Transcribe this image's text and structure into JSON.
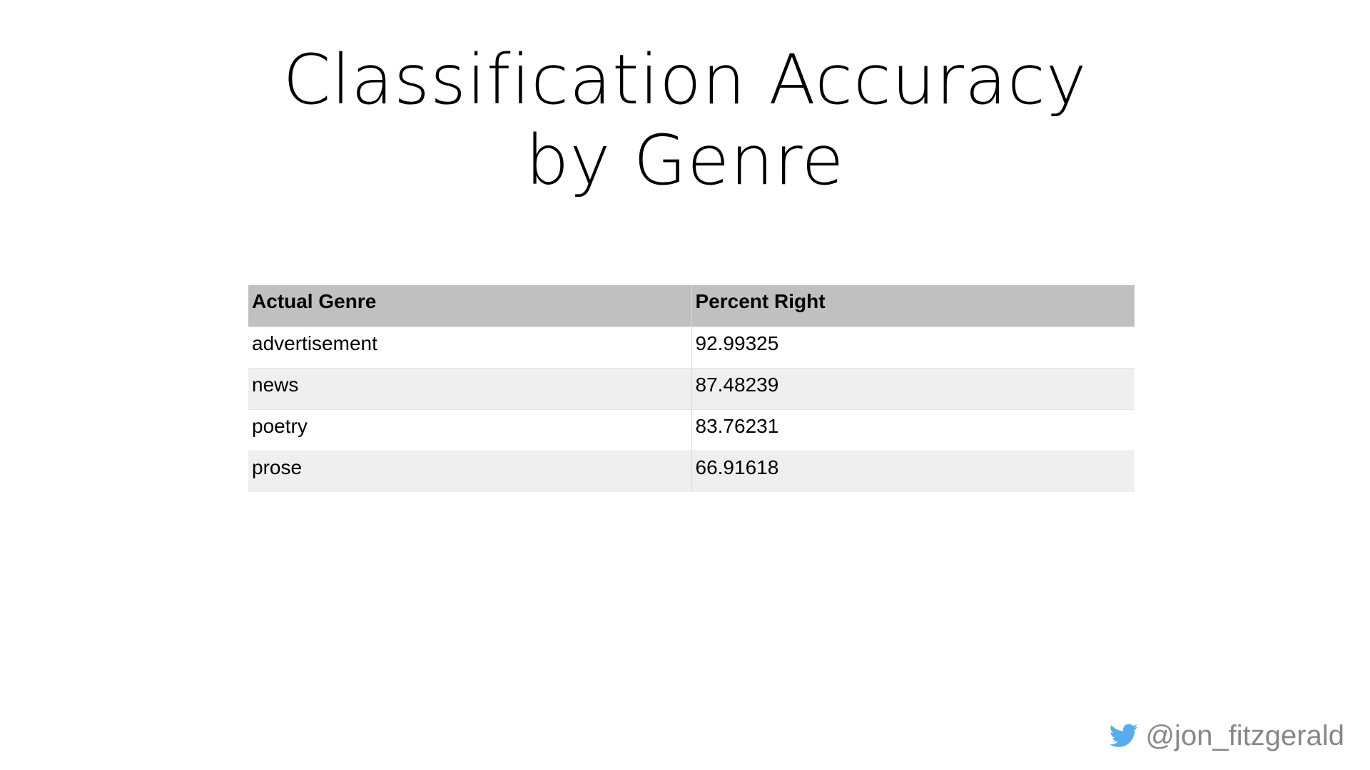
{
  "slide": {
    "title": "Classification Accuracy by Genre"
  },
  "chart_data": {
    "type": "table",
    "title": "Classification Accuracy by Genre",
    "columns": [
      "Actual Genre",
      "Percent Right"
    ],
    "rows": [
      [
        "advertisement",
        "92.99325"
      ],
      [
        "news",
        "87.48239"
      ],
      [
        "poetry",
        "83.76231"
      ],
      [
        "prose",
        "66.91618"
      ]
    ]
  },
  "footer": {
    "icon": "twitter-bird-icon",
    "handle": "@jon_fitzgerald",
    "icon_color": "#55acee",
    "text_color": "#888888"
  },
  "colors": {
    "header_bg": "#bfc0bf",
    "row_even_bg": "#efefef",
    "row_odd_bg": "#ffffff"
  }
}
